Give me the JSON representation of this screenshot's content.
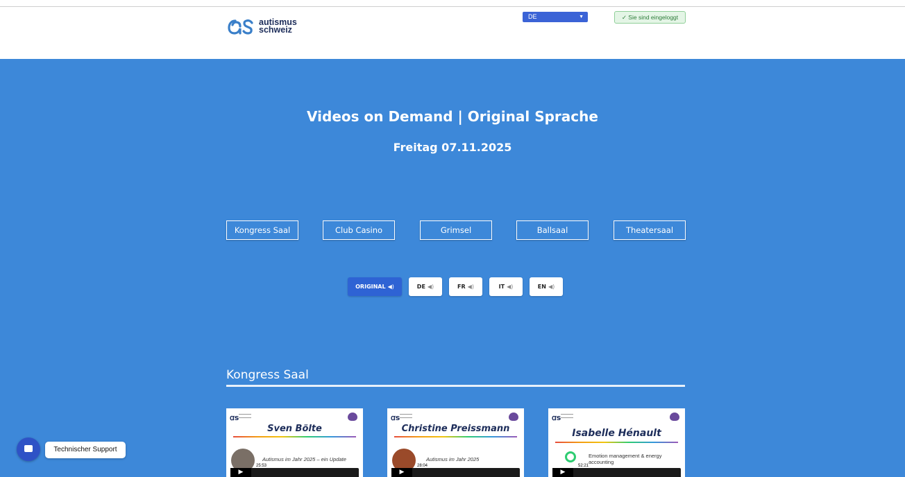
{
  "header": {
    "logo_line1": "autismus",
    "logo_line2": "schweiz",
    "language_selected": "DE",
    "login_status": "✓ Sie sind eingeloggt"
  },
  "hero": {
    "title": "Videos on Demand | Original Sprache",
    "date": "Freitag 07.11.2025"
  },
  "rooms": [
    "Kongress Saal",
    "Club Casino",
    "Grimsel",
    "Ballsaal",
    "Theatersaal"
  ],
  "audio_tracks": [
    {
      "label": "ORIGINAL",
      "active": true
    },
    {
      "label": "DE",
      "active": false
    },
    {
      "label": "FR",
      "active": false
    },
    {
      "label": "IT",
      "active": false
    },
    {
      "label": "EN",
      "active": false
    }
  ],
  "section": {
    "title": "Kongress Saal"
  },
  "videos": [
    {
      "speaker": "Sven Bölte",
      "subtitle": "Autismus im Jahr 2025 – ein Update",
      "duration": "25:53"
    },
    {
      "speaker": "Christine Preissmann",
      "subtitle": "Autismus im Jahr 2025",
      "duration": "28:04"
    },
    {
      "speaker": "Isabelle Hénault",
      "subtitle": "Emotion management & energy accounting",
      "duration": "52:21"
    }
  ],
  "support": {
    "label": "Technischer Support"
  },
  "colors": {
    "hero_bg": "#3d88d9",
    "active_button": "#2e63d4",
    "brand_navy": "#1d2d5a",
    "support_button": "#2e52c6"
  }
}
